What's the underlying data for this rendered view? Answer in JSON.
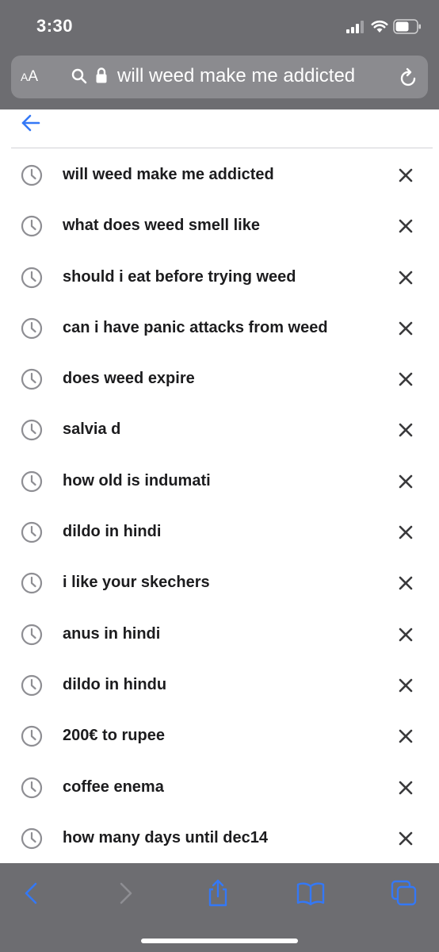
{
  "status_bar": {
    "time": "3:30",
    "signal_icon": "cellular-signal-icon",
    "wifi_icon": "wifi-icon",
    "battery_icon": "battery-icon"
  },
  "address_bar": {
    "aa_large": "A",
    "aa_small": "A",
    "url_text": "will weed make me addicted",
    "search_icon": "search-icon",
    "lock_icon": "lock-icon",
    "reload_icon": "reload-icon"
  },
  "navigation": {
    "back_icon": "back-arrow-icon"
  },
  "suggestions": [
    {
      "label": "will weed make me addicted"
    },
    {
      "label": "what does weed smell like"
    },
    {
      "label": "should i eat before trying weed"
    },
    {
      "label": "can i have panic attacks from weed"
    },
    {
      "label": "does weed expire"
    },
    {
      "label": "salvia d"
    },
    {
      "label": "how old is indumati"
    },
    {
      "label": "dildo in hindi"
    },
    {
      "label": "i like your skechers"
    },
    {
      "label": "anus in hindi"
    },
    {
      "label": "dildo in hindu"
    },
    {
      "label": "200€ to rupee"
    },
    {
      "label": "coffee enema"
    },
    {
      "label": "how many days until dec14"
    }
  ],
  "toolbar": {
    "icons": [
      "back-chevron-icon",
      "forward-chevron-icon",
      "share-icon",
      "bookmarks-icon",
      "tabs-icon"
    ]
  },
  "colors": {
    "chrome": "#6d6d71",
    "address_field": "#8b8b8f",
    "accent": "#3478f6",
    "icon_gray": "#8e8e93"
  }
}
